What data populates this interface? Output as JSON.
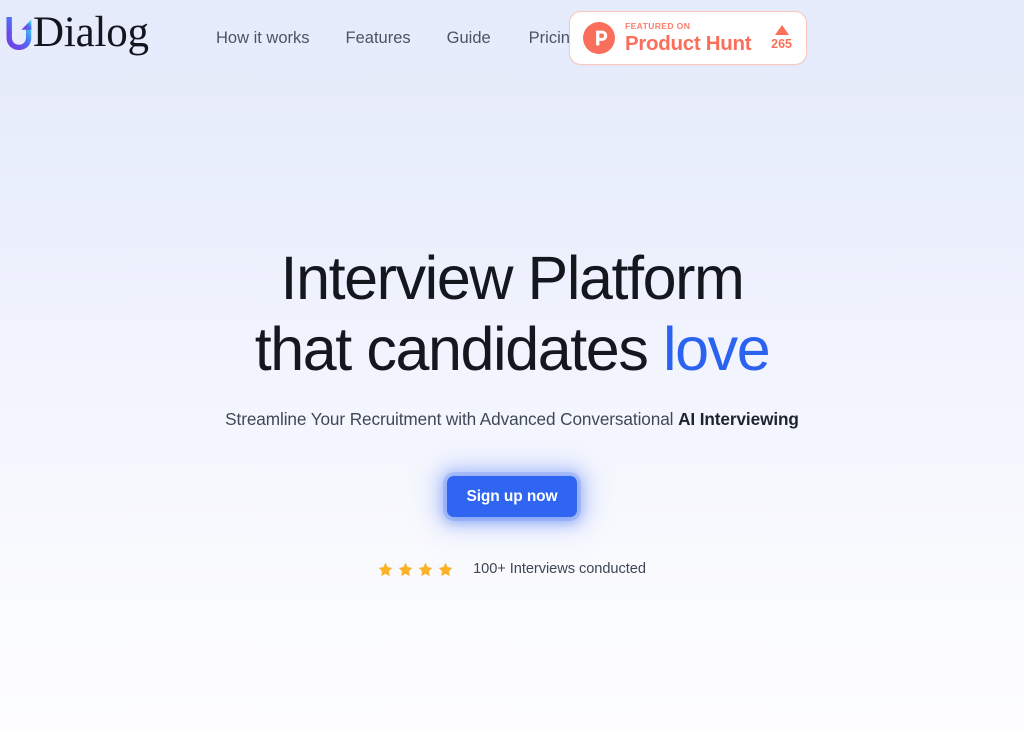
{
  "brand": {
    "name": "Dialog",
    "logo_icon": "dialog-swirl-arrow-icon",
    "gradient_start": "#7b3fe4",
    "gradient_mid": "#4f6ef7",
    "gradient_end": "#3fe0e0"
  },
  "nav": {
    "items": [
      {
        "label": "How it works"
      },
      {
        "label": "Features"
      },
      {
        "label": "Guide"
      },
      {
        "label": "Pricing"
      }
    ]
  },
  "product_hunt_badge": {
    "featured_label": "FEATURED ON",
    "name": "Product Hunt",
    "logo_letter": "P",
    "upvote_icon": "upvote-triangle-icon",
    "upvote_count": "265",
    "brand_color": "#fa6f5b",
    "border_color": "#fbc7bd"
  },
  "hero": {
    "headline_line1": "Interview Platform",
    "headline_line2_plain": "that candidates ",
    "headline_line2_accent": "love",
    "accent_color": "#2b62f0",
    "subtitle_plain": "Streamline Your Recruitment with Advanced Conversational ",
    "subtitle_strong": "AI Interviewing",
    "cta_label": "Sign up now",
    "cta_color": "#2f65f0",
    "social_proof_text": "100+ Interviews conducted",
    "star_count": 4,
    "star_color": "#f9b229"
  }
}
